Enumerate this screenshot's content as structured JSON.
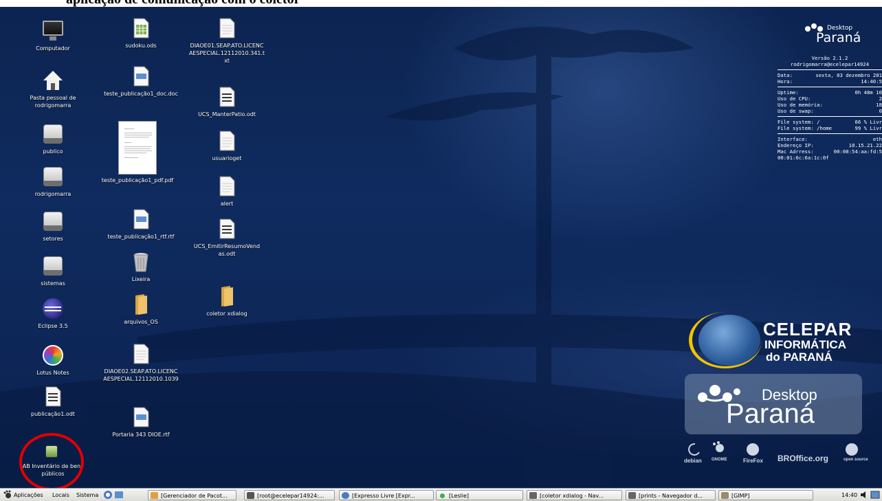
{
  "document_header": "aplicação de comunicação com o coletor",
  "desktop_icons": {
    "col1": [
      {
        "label": "Computador"
      },
      {
        "label": "Pasta pessoal de rodrigomarra"
      },
      {
        "label": "publico"
      },
      {
        "label": "rodrigomarra"
      },
      {
        "label": "setores"
      },
      {
        "label": "sistemas"
      },
      {
        "label": "Eclipse 3.5"
      },
      {
        "label": "Lotus Notes"
      },
      {
        "label": "publicação1.odt"
      },
      {
        "label": "AB Inventário de bens públicos"
      }
    ],
    "col2": [
      {
        "label": "sudoku.ods"
      },
      {
        "label": "teste_publicação1_doc.doc"
      },
      {
        "label": "teste_publicação1_pdf.pdf"
      },
      {
        "label": "teste_publicação1_rtf.rtf"
      },
      {
        "label": "Lixeira"
      },
      {
        "label": "arquivos_OS"
      },
      {
        "label": "DIAOE02.SEAP.ATO.LICENCAESPECIAL.12112010.1039"
      },
      {
        "label": "Portaria 343 DIOE.rtf"
      }
    ],
    "col3": [
      {
        "label": "DIAOE01.SEAP.ATO.LICENCAESPECIAL.12112010.341.txt"
      },
      {
        "label": "UCS_ManterPatio.odt"
      },
      {
        "label": "usuarioget"
      },
      {
        "label": "alert"
      },
      {
        "label": "UCS_EmitirResumoVendas.odt"
      },
      {
        "label": "coletor xdialog"
      }
    ]
  },
  "conky": {
    "logo_small": {
      "desktop": "Desktop",
      "parana": "Paraná"
    },
    "version": "Versão 2.1.2",
    "user": "rodrigomarra@ecelepar14924",
    "date_label": "Data:",
    "date_value": "sexta, 03 dezembro 201",
    "time_label": "Hora:",
    "time_value": "14:40:5",
    "uptime_label": "Uptime:",
    "uptime_value": "0h 48m 10",
    "cpu_label": "Uso de CPU:",
    "cpu_value": "2",
    "mem_label": "Uso de memória:",
    "mem_value": "18",
    "swap_label": "Uso de swap:",
    "swap_value": "0",
    "fs1_label": "File system: /",
    "fs1_value": "66 % Livr",
    "fs2_label": "File system: /home",
    "fs2_value": "99 % Livr",
    "iface_label": "Interface:",
    "iface_value": "eth",
    "ip_label": "Endereço IP:",
    "ip_value": "10.15.21.22",
    "mac_label": "Mac Adrress:",
    "mac_value": "00:08:54:aa:fd:5",
    "mac2": "00:01:6c:6a:1c:0f"
  },
  "branding": {
    "celepar_1": "CELEPAR",
    "celepar_2": "INFORMÁTICA",
    "celepar_3": "do PARANÁ",
    "desktop": "Desktop",
    "parana": "Paraná",
    "sponsors": [
      "debian",
      "GNOME",
      "FireFox",
      "BROffice.org",
      "open source"
    ]
  },
  "taskbar": {
    "menus": [
      "Aplicações",
      "Locais",
      "Sistema"
    ],
    "windows": [
      "[Gerenciador de Pacot...",
      "[root@ecelepar14924:...",
      "[Expresso Livre [Expr...",
      "[Leslie]",
      "[coletor xdialog - Nav...",
      "[prints - Navegador d...",
      "[GIMP]"
    ],
    "clock": "14:40"
  },
  "colors": {
    "desktop_bg": "#0f2b5f",
    "highlight_circle": "#e00000",
    "celepar_ring": "#f2c300"
  }
}
